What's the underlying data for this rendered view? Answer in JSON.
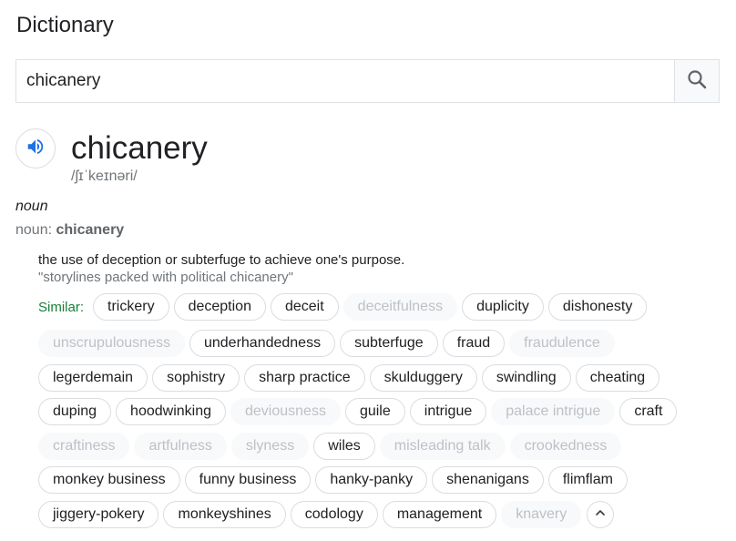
{
  "header": {
    "title": "Dictionary"
  },
  "search": {
    "value": "chicanery"
  },
  "entry": {
    "word": "chicanery",
    "phonetic": "/ʃɪˈkeɪnəri/",
    "part_of_speech": "noun",
    "noun_prefix": "noun: ",
    "noun_word": "chicanery",
    "definition": "the use of deception or subterfuge to achieve one's purpose.",
    "example": "\"storylines packed with political chicanery\""
  },
  "synonyms": {
    "label": "Similar:",
    "rows": [
      [
        {
          "text": "trickery",
          "dim": false
        },
        {
          "text": "deception",
          "dim": false
        },
        {
          "text": "deceit",
          "dim": false
        },
        {
          "text": "deceitfulness",
          "dim": true
        },
        {
          "text": "duplicity",
          "dim": false
        },
        {
          "text": "dishonesty",
          "dim": false
        }
      ],
      [
        {
          "text": "unscrupulousness",
          "dim": true
        },
        {
          "text": "underhandedness",
          "dim": false
        },
        {
          "text": "subterfuge",
          "dim": false
        },
        {
          "text": "fraud",
          "dim": false
        },
        {
          "text": "fraudulence",
          "dim": true
        }
      ],
      [
        {
          "text": "legerdemain",
          "dim": false
        },
        {
          "text": "sophistry",
          "dim": false
        },
        {
          "text": "sharp practice",
          "dim": false
        },
        {
          "text": "skulduggery",
          "dim": false
        },
        {
          "text": "swindling",
          "dim": false
        },
        {
          "text": "cheating",
          "dim": false
        }
      ],
      [
        {
          "text": "duping",
          "dim": false
        },
        {
          "text": "hoodwinking",
          "dim": false
        },
        {
          "text": "deviousness",
          "dim": true
        },
        {
          "text": "guile",
          "dim": false
        },
        {
          "text": "intrigue",
          "dim": false
        },
        {
          "text": "palace intrigue",
          "dim": true
        },
        {
          "text": "craft",
          "dim": false
        }
      ],
      [
        {
          "text": "craftiness",
          "dim": true
        },
        {
          "text": "artfulness",
          "dim": true
        },
        {
          "text": "slyness",
          "dim": true
        },
        {
          "text": "wiles",
          "dim": false
        },
        {
          "text": "misleading talk",
          "dim": true
        },
        {
          "text": "crookedness",
          "dim": true
        }
      ],
      [
        {
          "text": "monkey business",
          "dim": false
        },
        {
          "text": "funny business",
          "dim": false
        },
        {
          "text": "hanky-panky",
          "dim": false
        },
        {
          "text": "shenanigans",
          "dim": false
        },
        {
          "text": "flimflam",
          "dim": false
        }
      ],
      [
        {
          "text": "jiggery-pokery",
          "dim": false
        },
        {
          "text": "monkeyshines",
          "dim": false
        },
        {
          "text": "codology",
          "dim": false
        },
        {
          "text": "management",
          "dim": false
        },
        {
          "text": "knavery",
          "dim": true
        }
      ]
    ]
  },
  "icons": {
    "search": "search-icon",
    "speaker": "speaker-icon",
    "collapse": "chevron-up-icon"
  },
  "colors": {
    "accent_blue": "#1a73e8",
    "similar_green": "#188038",
    "dim_text": "#bdc1c6"
  }
}
